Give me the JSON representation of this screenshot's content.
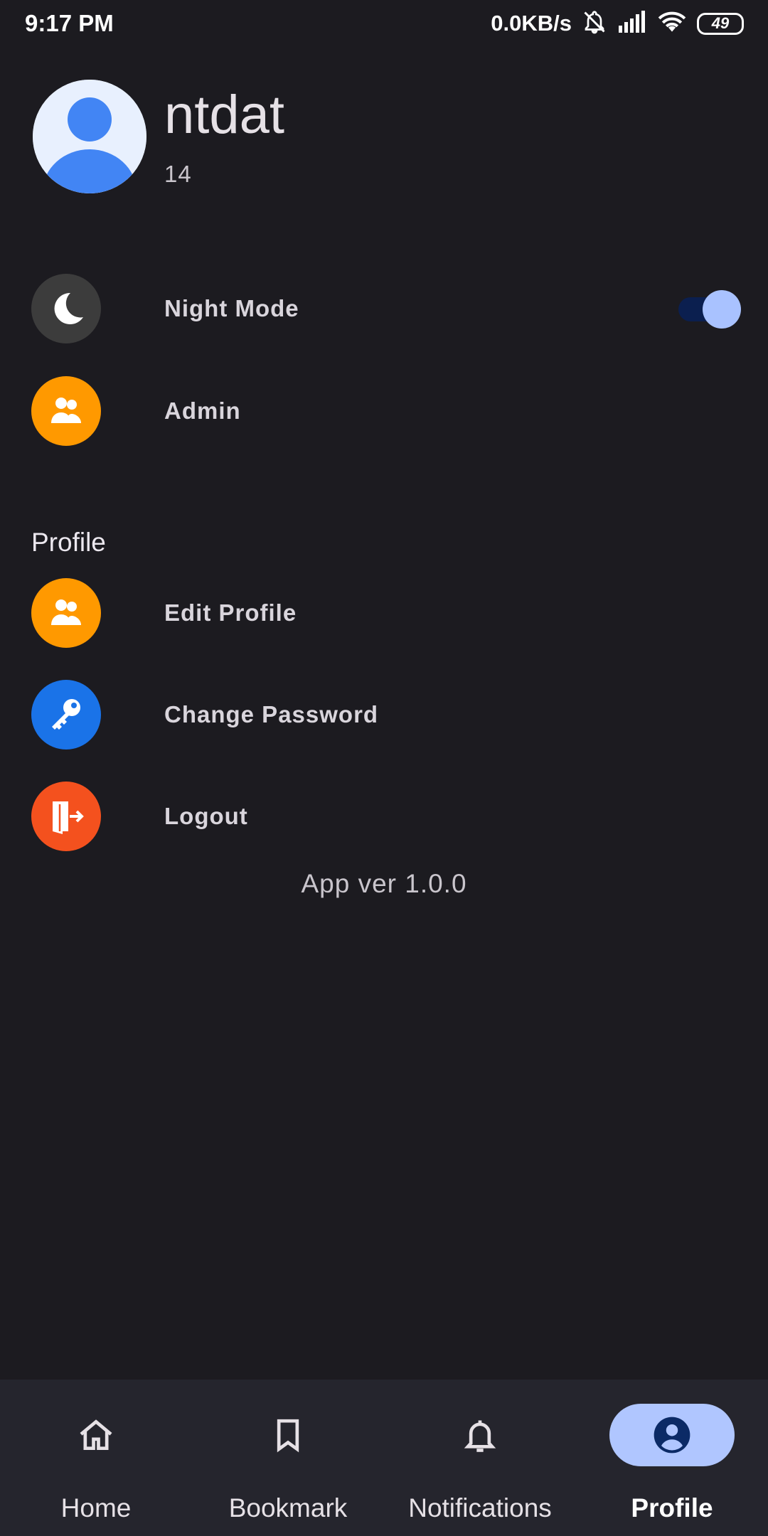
{
  "status_bar": {
    "time": "9:17 PM",
    "net_speed": "0.0KB/s",
    "battery": "49",
    "icons": [
      "bell-off-icon",
      "signal-icon",
      "wifi-icon",
      "battery-icon"
    ]
  },
  "profile": {
    "name": "ntdat",
    "id": "14",
    "avatar_icon": "person-avatar-icon"
  },
  "settings": {
    "night_mode": {
      "label": "Night Mode",
      "icon": "moon-icon",
      "enabled": true
    },
    "admin": {
      "label": "Admin",
      "icon": "users-icon"
    }
  },
  "profile_section": {
    "title": "Profile",
    "items": [
      {
        "label": "Edit Profile",
        "icon": "users-icon"
      },
      {
        "label": "Change Password",
        "icon": "key-icon"
      },
      {
        "label": "Logout",
        "icon": "logout-icon"
      }
    ]
  },
  "app_version": "App ver 1.0.0",
  "bottom_nav": {
    "items": [
      {
        "label": "Home",
        "icon": "home-icon"
      },
      {
        "label": "Bookmark",
        "icon": "bookmark-icon"
      },
      {
        "label": "Notifications",
        "icon": "bell-icon"
      },
      {
        "label": "Profile",
        "icon": "account-circle-icon",
        "active": true
      }
    ]
  },
  "colors": {
    "background": "#1c1b20",
    "nav_background": "#25252d",
    "nav_active": "#b0c6ff",
    "orange": "#ff9900",
    "blue": "#1a73e8",
    "red_orange": "#f4511e",
    "moon_bg": "#3c3c3c",
    "toggle_track": "#0b1f4f",
    "toggle_thumb": "#a9c2ff"
  }
}
